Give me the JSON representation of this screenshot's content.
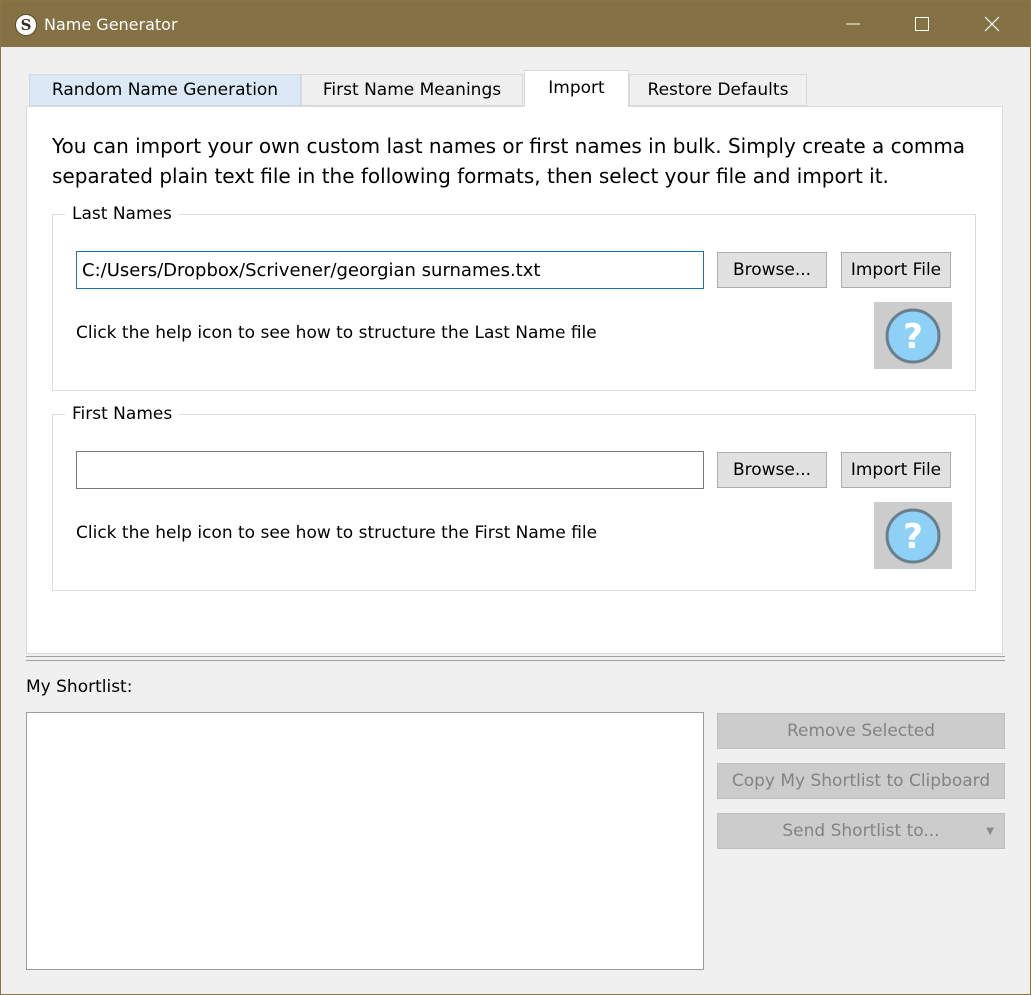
{
  "window": {
    "title": "Name Generator",
    "app_icon_letter": "S"
  },
  "tabs": [
    {
      "label": "Random Name Generation"
    },
    {
      "label": "First Name Meanings"
    },
    {
      "label": "Import"
    },
    {
      "label": "Restore Defaults"
    }
  ],
  "import": {
    "intro": "You can import your own custom last names or first names in bulk. Simply create a comma separated plain text file in the following formats, then select your file and import it.",
    "last_names": {
      "legend": "Last Names",
      "path_value": "C:/Users/Dropbox/Scrivener/georgian surnames.txt",
      "browse_label": "Browse...",
      "import_label": "Import File",
      "help_text": "Click the help icon to see how to structure the Last Name file"
    },
    "first_names": {
      "legend": "First Names",
      "path_value": "",
      "browse_label": "Browse...",
      "import_label": "Import File",
      "help_text": "Click the help icon to see how to structure the First Name file"
    }
  },
  "shortlist": {
    "label": "My Shortlist:",
    "remove_label": "Remove Selected",
    "copy_label": "Copy My Shortlist to Clipboard",
    "send_label": "Send Shortlist to..."
  },
  "colors": {
    "titlebar": "#847144",
    "active_tab": "#ffffff",
    "first_tab": "#dbe9f7",
    "help_icon": "#8fd0f7",
    "disabled_text": "#838383"
  }
}
